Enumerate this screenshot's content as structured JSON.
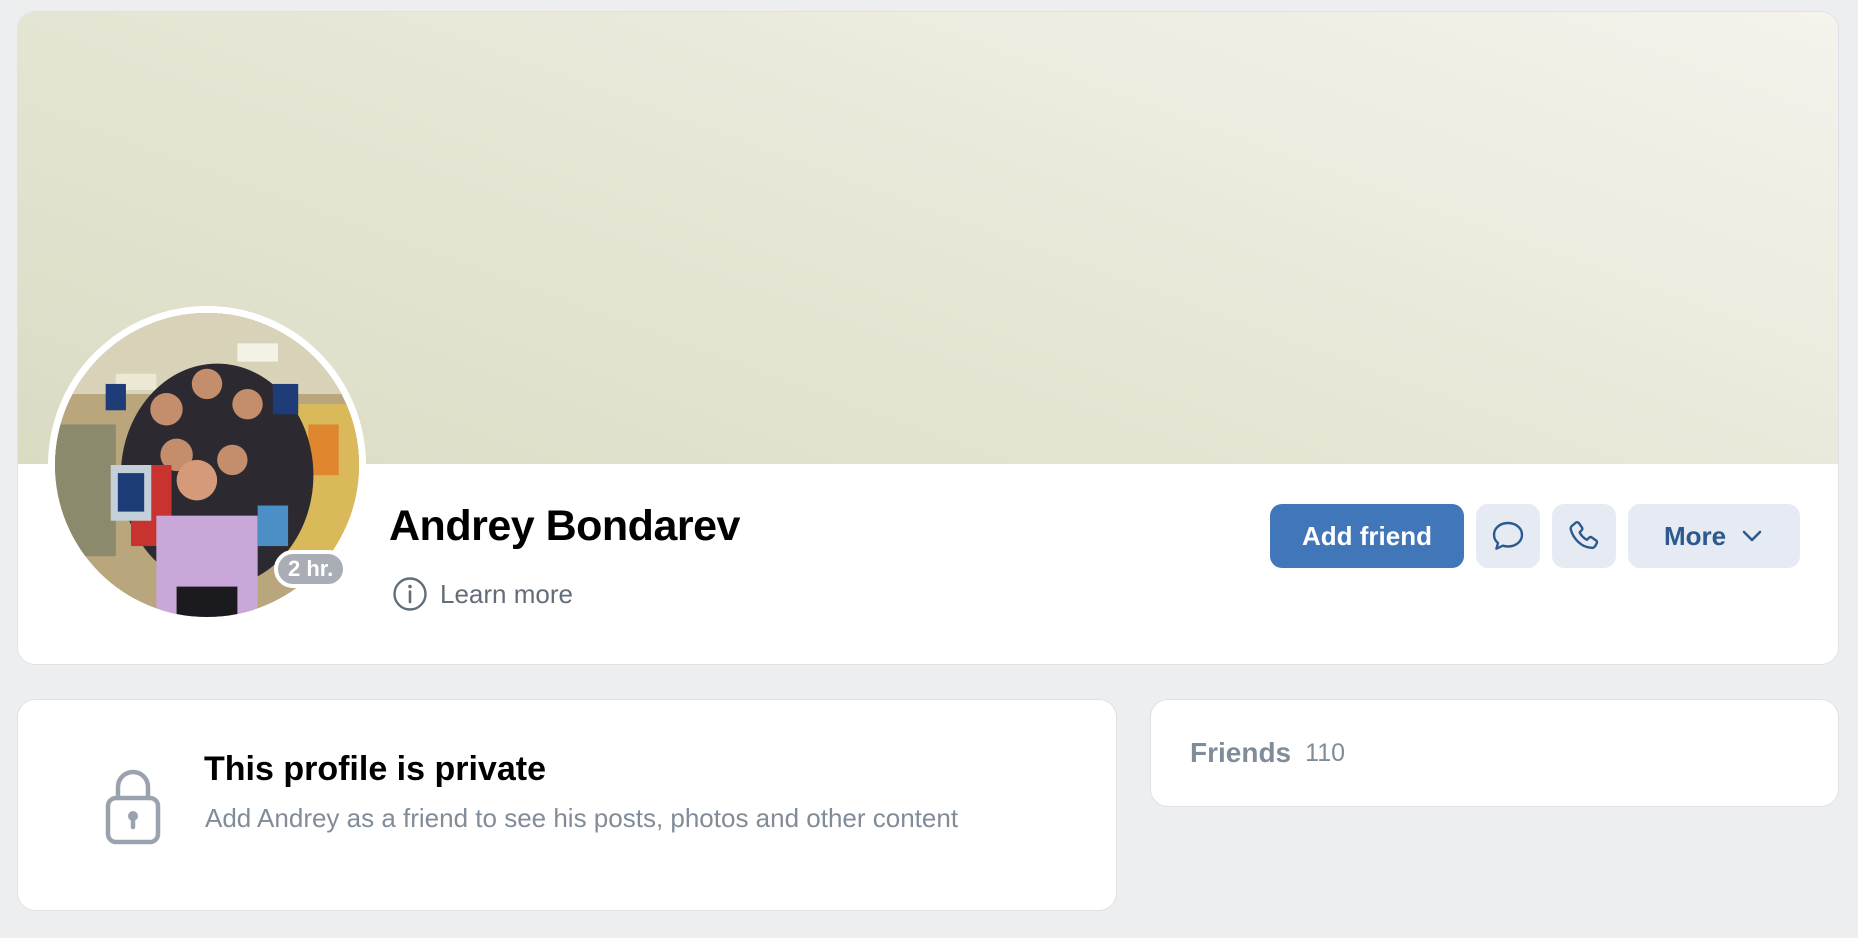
{
  "profile": {
    "name": "Andrey Bondarev",
    "last_seen": "2 hr.",
    "learn_more": "Learn more"
  },
  "actions": {
    "add_friend": "Add friend",
    "more": "More"
  },
  "private_notice": {
    "title": "This profile is private",
    "description": "Add Andrey as a friend to see his posts, photos and other content"
  },
  "friends": {
    "label": "Friends",
    "count": "110"
  },
  "icons": {
    "info": "info-circle-icon",
    "message": "message-bubble-icon",
    "call": "phone-icon",
    "dropdown": "chevron-down-icon",
    "lock": "lock-icon"
  },
  "colors": {
    "primary_button": "#4176b8",
    "secondary_button": "#e6ebf3",
    "secondary_text": "#818c99",
    "page_background": "#edeef0"
  }
}
